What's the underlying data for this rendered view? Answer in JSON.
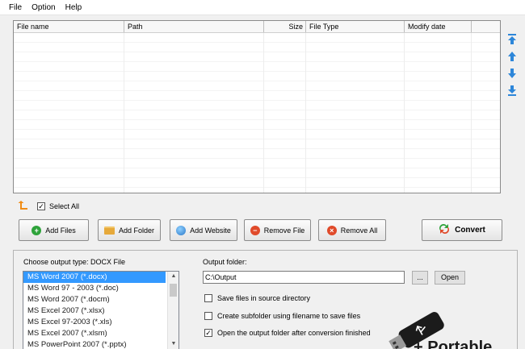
{
  "menu": [
    "File",
    "Option",
    "Help"
  ],
  "file_list": {
    "columns": [
      "File name",
      "Path",
      "Size",
      "File Type",
      "Modify date",
      ""
    ]
  },
  "move_buttons": [
    "move-top-icon",
    "move-up-icon",
    "move-down-icon",
    "move-bottom-icon"
  ],
  "select_all": {
    "label": "Select All",
    "checked": true
  },
  "toolbar": {
    "add_files": "Add Files",
    "add_folder": "Add Folder",
    "add_website": "Add Website",
    "remove_file": "Remove File",
    "remove_all": "Remove All",
    "convert": "Convert"
  },
  "output_type": {
    "label": "Choose output type:  DOCX File",
    "options": [
      "MS Word 2007 (*.docx)",
      "MS Word 97 - 2003 (*.doc)",
      "MS Word 2007 (*.docm)",
      "MS Excel 2007 (*.xlsx)",
      "MS Excel 97-2003 (*.xls)",
      "MS Excel 2007 (*.xlsm)",
      "MS PowerPoint 2007 (*.pptx)"
    ],
    "selected_index": 0
  },
  "output_folder": {
    "label": "Output folder:",
    "value": "C:\\Output",
    "browse_label": "...",
    "open_label": "Open"
  },
  "options": {
    "save_in_source": {
      "label": "Save files in source directory",
      "checked": false
    },
    "create_subfolder": {
      "label": "Create subfolder using filename to save files",
      "checked": false
    },
    "open_after": {
      "label": "Open the output folder after conversion finished",
      "checked": true
    }
  },
  "watermark": {
    "text": "+ Portable"
  },
  "colors": {
    "selection": "#3399ff",
    "move_arrows": "#2d86d9",
    "add_files_icon": "#2ea33a",
    "remove_icon": "#e04a2a",
    "folder_icon": "#e6a93a"
  }
}
